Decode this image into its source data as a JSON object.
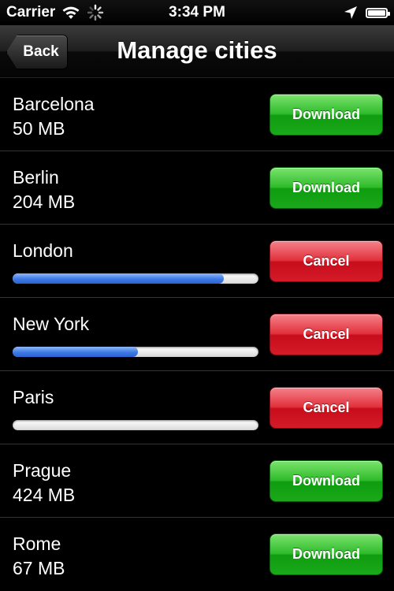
{
  "status_bar": {
    "carrier": "Carrier",
    "time": "3:34 PM",
    "icons": [
      "wifi-icon",
      "activity-spinner-icon",
      "location-arrow-icon",
      "battery-icon"
    ]
  },
  "nav": {
    "back_label": "Back",
    "title": "Manage cities"
  },
  "colors": {
    "download": "#1aa91a",
    "cancel": "#d51b28",
    "progress": "#3c7ae6"
  },
  "cities": [
    {
      "name": "Barcelona",
      "size": "50 MB",
      "action": "Download"
    },
    {
      "name": "Berlin",
      "size": "204 MB",
      "action": "Download"
    },
    {
      "name": "London",
      "action": "Cancel",
      "progress": 0.86
    },
    {
      "name": "New York",
      "action": "Cancel",
      "progress": 0.51
    },
    {
      "name": "Paris",
      "action": "Cancel",
      "progress": 0.0
    },
    {
      "name": "Prague",
      "size": "424 MB",
      "action": "Download"
    },
    {
      "name": "Rome",
      "size": "67 MB",
      "action": "Download"
    }
  ]
}
